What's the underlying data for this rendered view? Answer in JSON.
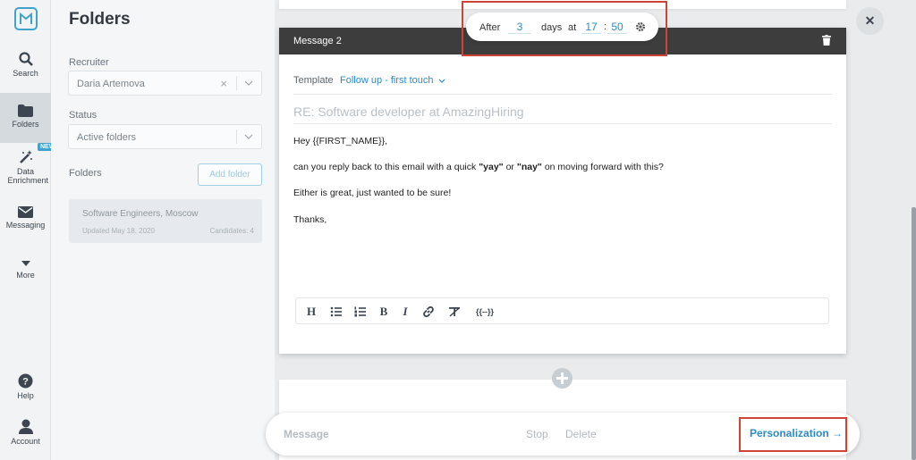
{
  "nav": {
    "items": [
      {
        "label": "Search",
        "icon": "search-icon"
      },
      {
        "label": "Folders",
        "icon": "folder-icon",
        "active": true
      },
      {
        "label": "Data Enrichment",
        "icon": "magic-wand-icon",
        "badge": "NEW"
      },
      {
        "label": "Messaging",
        "icon": "envelope-icon"
      },
      {
        "label": "More",
        "icon": "caret-down-icon"
      },
      {
        "label": "Help",
        "icon": "help-icon"
      },
      {
        "label": "Account",
        "icon": "user-icon"
      }
    ]
  },
  "panel": {
    "title": "Folders",
    "recruiter_label": "Recruiter",
    "recruiter_value": "Daria Artemova",
    "status_label": "Status",
    "status_value": "Active folders",
    "folders_label": "Folders",
    "add_folder_label": "Add folder",
    "folder": {
      "name": "Software Engineers, Moscow",
      "updated": "Updated May 18, 2020",
      "candidates": "Candidates: 4"
    }
  },
  "schedule": {
    "after_label": "After",
    "days_value": "3",
    "days_label": "days",
    "at_label": "at",
    "hour": "17",
    "colon": ":",
    "minute": "50"
  },
  "message": {
    "title": "Message 2",
    "template_label": "Template",
    "template_value": "Follow up - first touch",
    "subject": "RE: Software developer at AmazingHiring",
    "body": {
      "greeting": "Hey {{FIRST_NAME}},",
      "line2_pre": "can you reply back to this email with a quick ",
      "yay": "\"yay\"",
      "or": " or ",
      "nay": "\"nay\"",
      "line2_post": " on moving forward with this?",
      "line3": "Either is great, just wanted to be sure!",
      "line4": "Thanks,"
    },
    "toolbar": {
      "heading": "H",
      "bold": "B",
      "italic": "I",
      "variables": "{{--}}"
    }
  },
  "actions": {
    "message_label": "Message",
    "stop_label": "Stop",
    "delete_label": "Delete",
    "personalization_label": "Personalization",
    "arrow": "→"
  },
  "close_glyph": "✕",
  "colors": {
    "accent": "#2d8cc0",
    "header": "#3d3d3d",
    "highlight": "#d04437",
    "badge": "#3ea4cf"
  }
}
